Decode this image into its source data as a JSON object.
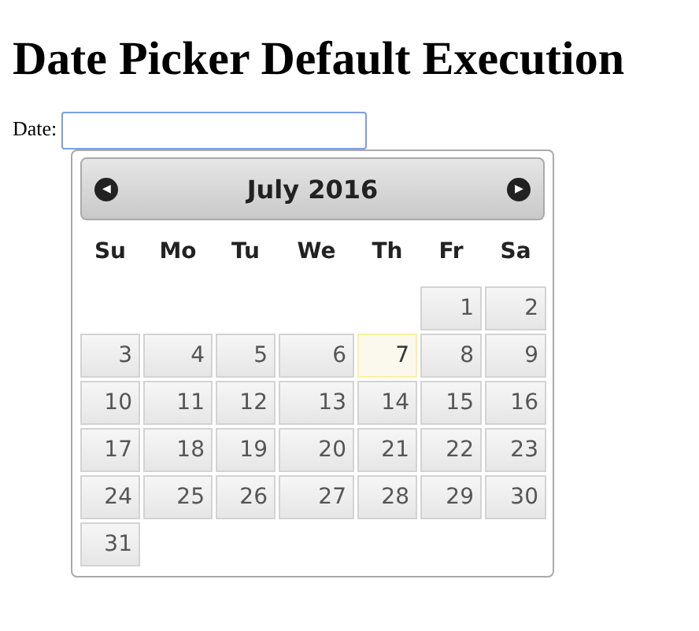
{
  "title": "Date Picker Default Execution",
  "field": {
    "label": "Date:"
  },
  "calendar": {
    "prev": "◀",
    "next": "▶",
    "month": "July 2016",
    "weekdays": [
      "Su",
      "Mo",
      "Tu",
      "We",
      "Th",
      "Fr",
      "Sa"
    ],
    "weeks": [
      {
        "days": [
          {
            "kind": "blank"
          },
          {
            "kind": "blank"
          },
          {
            "kind": "blank"
          },
          {
            "kind": "blank"
          },
          {
            "kind": "blank"
          },
          {
            "kind": "day",
            "label": "1",
            "today": false
          },
          {
            "kind": "day",
            "label": "2",
            "today": false
          }
        ]
      },
      {
        "days": [
          {
            "kind": "day",
            "label": "3",
            "today": false
          },
          {
            "kind": "day",
            "label": "4",
            "today": false
          },
          {
            "kind": "day",
            "label": "5",
            "today": false
          },
          {
            "kind": "day",
            "label": "6",
            "today": false
          },
          {
            "kind": "day",
            "label": "7",
            "today": true
          },
          {
            "kind": "day",
            "label": "8",
            "today": false
          },
          {
            "kind": "day",
            "label": "9",
            "today": false
          }
        ]
      },
      {
        "days": [
          {
            "kind": "day",
            "label": "10",
            "today": false
          },
          {
            "kind": "day",
            "label": "11",
            "today": false
          },
          {
            "kind": "day",
            "label": "12",
            "today": false
          },
          {
            "kind": "day",
            "label": "13",
            "today": false
          },
          {
            "kind": "day",
            "label": "14",
            "today": false
          },
          {
            "kind": "day",
            "label": "15",
            "today": false
          },
          {
            "kind": "day",
            "label": "16",
            "today": false
          }
        ]
      },
      {
        "days": [
          {
            "kind": "day",
            "label": "17",
            "today": false
          },
          {
            "kind": "day",
            "label": "18",
            "today": false
          },
          {
            "kind": "day",
            "label": "19",
            "today": false
          },
          {
            "kind": "day",
            "label": "20",
            "today": false
          },
          {
            "kind": "day",
            "label": "21",
            "today": false
          },
          {
            "kind": "day",
            "label": "22",
            "today": false
          },
          {
            "kind": "day",
            "label": "23",
            "today": false
          }
        ]
      },
      {
        "days": [
          {
            "kind": "day",
            "label": "24",
            "today": false
          },
          {
            "kind": "day",
            "label": "25",
            "today": false
          },
          {
            "kind": "day",
            "label": "26",
            "today": false
          },
          {
            "kind": "day",
            "label": "27",
            "today": false
          },
          {
            "kind": "day",
            "label": "28",
            "today": false
          },
          {
            "kind": "day",
            "label": "29",
            "today": false
          },
          {
            "kind": "day",
            "label": "30",
            "today": false
          }
        ]
      },
      {
        "days": [
          {
            "kind": "day",
            "label": "31",
            "today": false
          }
        ]
      }
    ]
  }
}
